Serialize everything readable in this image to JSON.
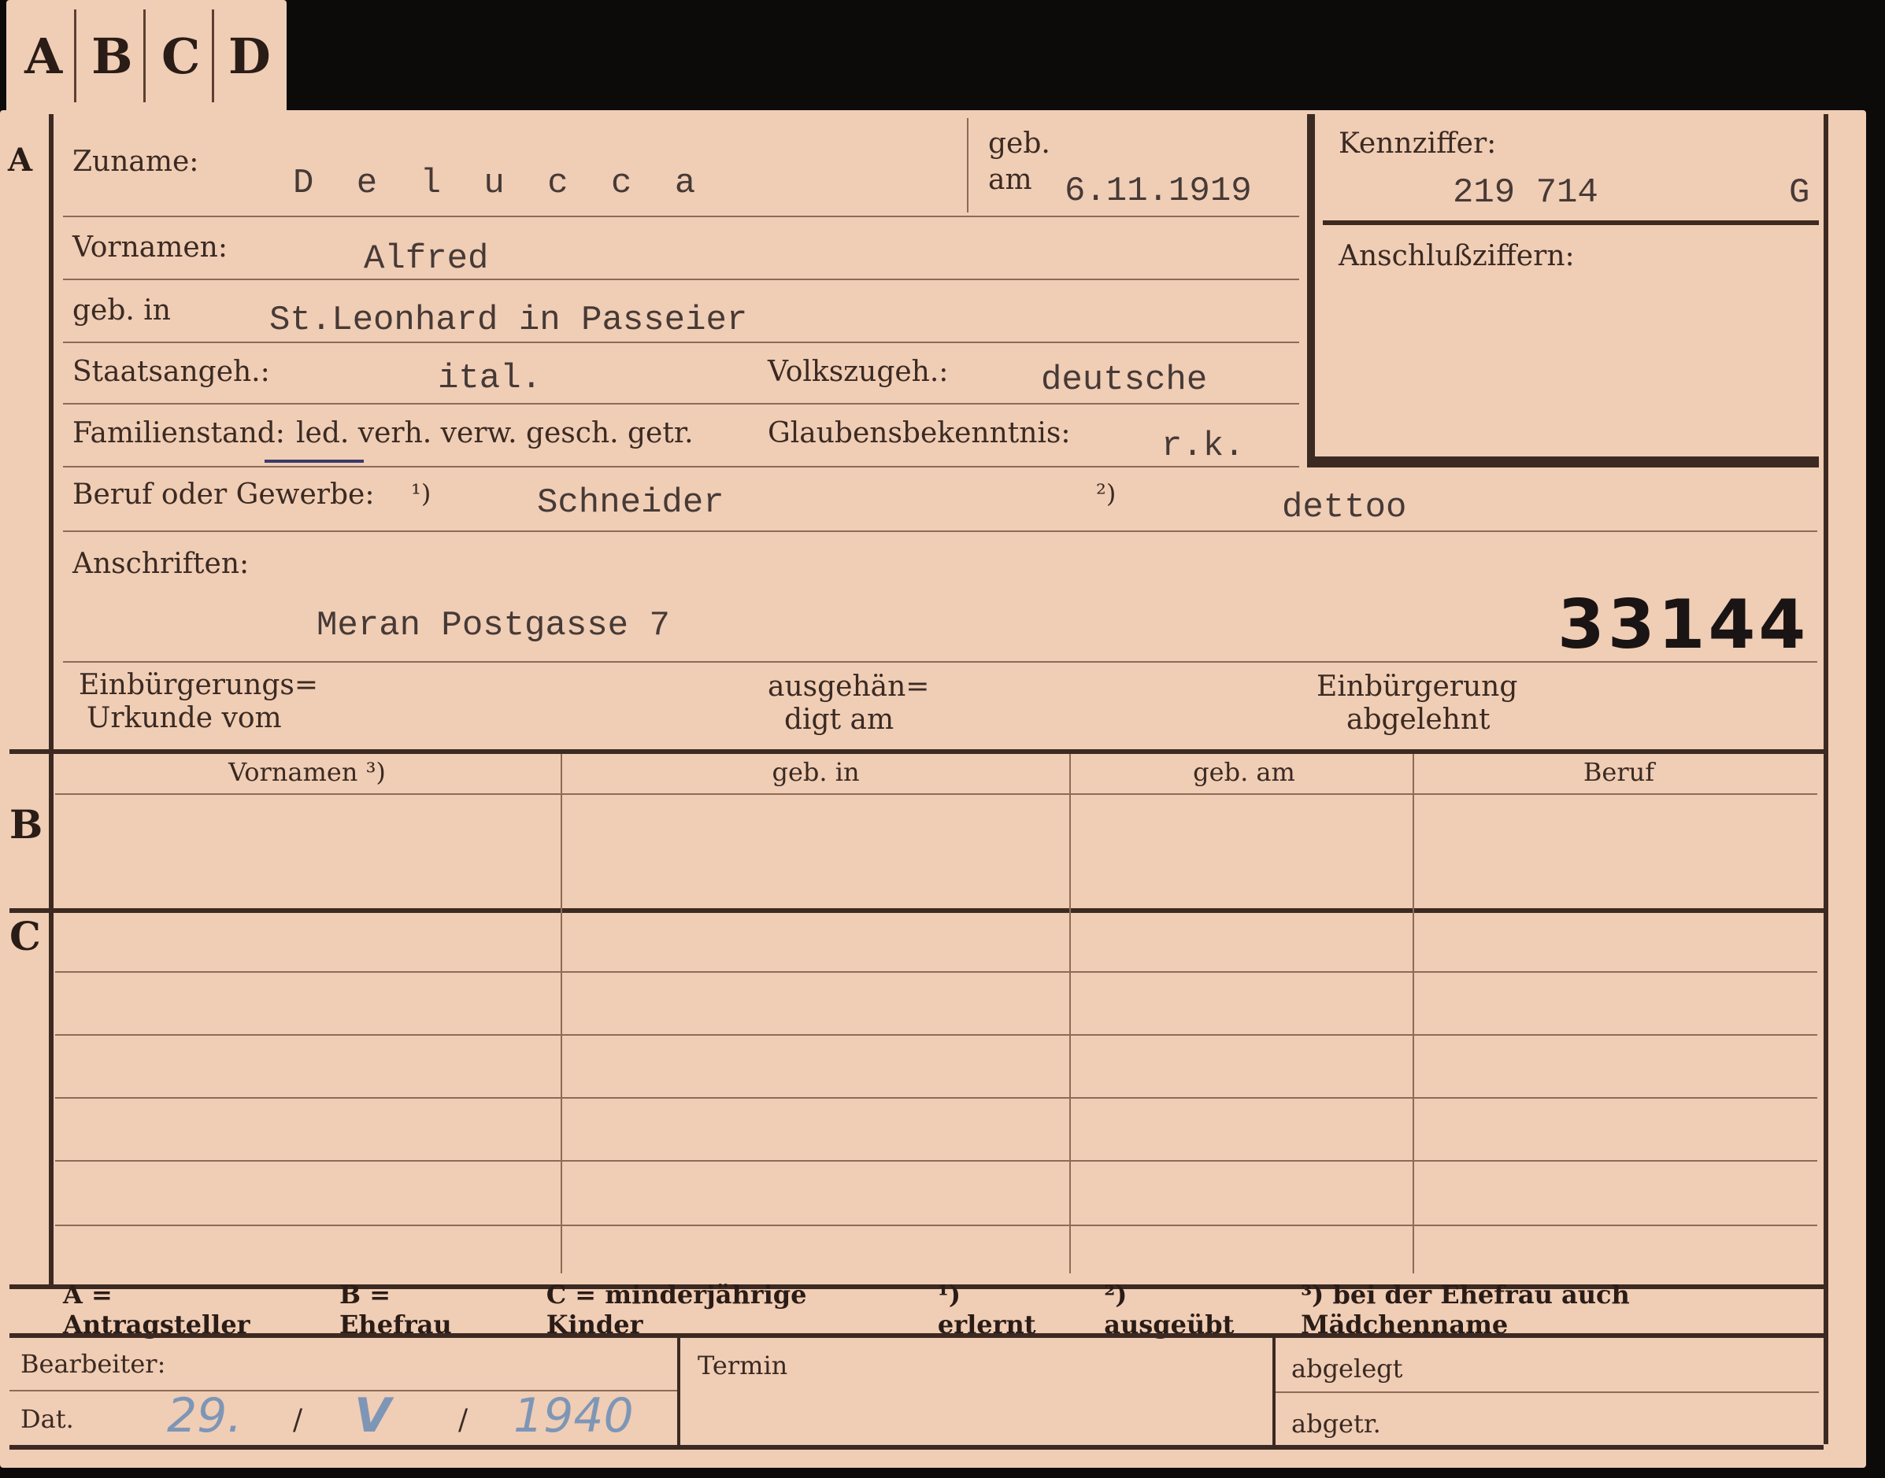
{
  "tabs": [
    "A",
    "B",
    "C",
    "D"
  ],
  "section_a": {
    "marker": "A",
    "zuname_label": "Zuname:",
    "zuname_value": "D e l u c c a",
    "geb_label": "geb.",
    "am_label": "am",
    "geb_am_value": "6.11.1919",
    "kennziffer_label": "Kennziffer:",
    "kennziffer_value": "219 714",
    "kennziffer_suffix": "G",
    "anschluss_label": "Anschlußziffern:",
    "vornamen_label": "Vornamen:",
    "vornamen_value": "Alfred",
    "geb_in_label": "geb. in",
    "geb_in_value": "St.Leonhard in Passeier",
    "staatsangeh_label": "Staatsangeh.:",
    "staatsangeh_value": "ital.",
    "volkszugeh_label": "Volkszugeh.:",
    "volkszugeh_value": "deutsche",
    "familienstand_label": "Familienstand:",
    "familienstand_options": "led. verh. verw. gesch. getr.",
    "glauben_label": "Glaubensbekenntnis:",
    "glauben_value": "r.k.",
    "beruf_label": "Beruf oder Gewerbe:",
    "beruf_note1": "¹)",
    "beruf_value1": "Schneider",
    "beruf_note2": "²)",
    "beruf_value2": "dettoo",
    "anschriften_label": "Anschriften:",
    "anschrift_value": "Meran Postgasse 7",
    "stamp_number": "33144",
    "einb_urkunde_label1": "Einbürgerungs=",
    "einb_urkunde_label2": "Urkunde vom",
    "ausgehaendigt_label1": "ausgehän=",
    "ausgehaendigt_label2": "digt am",
    "einb_abgelehnt_label1": "Einbürgerung",
    "einb_abgelehnt_label2": "abgelehnt"
  },
  "section_b": {
    "marker": "B",
    "columns": [
      "Vornamen ³)",
      "geb. in",
      "geb. am",
      "Beruf"
    ]
  },
  "section_c": {
    "marker": "C"
  },
  "legend": [
    "A = Antragsteller",
    "B = Ehefrau",
    "C = minderjährige Kinder",
    "¹) erlernt",
    "²) ausgeübt",
    "³) bei der Ehefrau auch Mädchenname"
  ],
  "footer": {
    "bearbeiter_label": "Bearbeiter:",
    "dat_label": "Dat.",
    "dat_day": "29.",
    "dat_month": "V",
    "dat_year": "1940",
    "sep": "/",
    "termin_label": "Termin",
    "abgelegt_label": "abgelegt",
    "abgetr_label": "abgetr."
  }
}
